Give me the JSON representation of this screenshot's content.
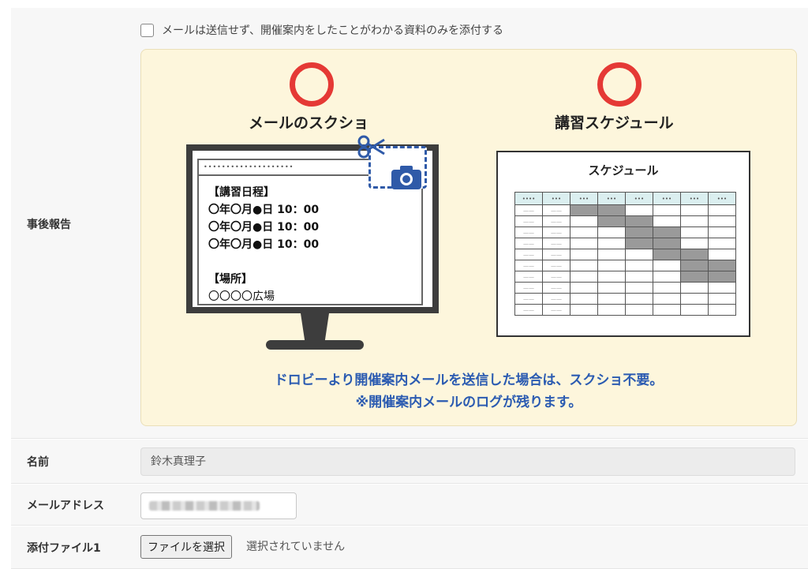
{
  "report_row": {
    "label": "事後報告",
    "checkbox_label": "メールは送信せず、開催案内をしたことがわかる資料のみを添付する",
    "illustration": {
      "left_heading": "メールのスクショ",
      "right_heading": "講習スケジュール",
      "monitor_bar": "••••••••••••••••••••",
      "monitor_lines": {
        "schedule_header": "【講習日程】",
        "date1": "〇年〇月●日 10：00",
        "date2": "〇年〇月●日 10：00",
        "date3": "〇年〇月●日 10：00",
        "venue_header": "【場所】",
        "venue": "〇〇〇〇広場"
      },
      "schedule_title": "スケジュール",
      "schedule_header_cells": [
        "••••",
        "•••",
        "•••",
        "•••",
        "•••",
        "•••",
        "•••",
        "•••"
      ],
      "note_line1": "ドロビーより開催案内メールを送信した場合は、スクショ不要。",
      "note_line2": "※開催案内メールのログが残ります。",
      "accent_red": "#e53935",
      "accent_blue": "#2b5bb1"
    }
  },
  "name_row": {
    "label": "名前",
    "value": "鈴木真理子"
  },
  "email_row": {
    "label": "メールアドレス"
  },
  "file_row": {
    "label": "添付ファイル1",
    "button_label": "ファイルを選択",
    "status": "選択されていません"
  }
}
